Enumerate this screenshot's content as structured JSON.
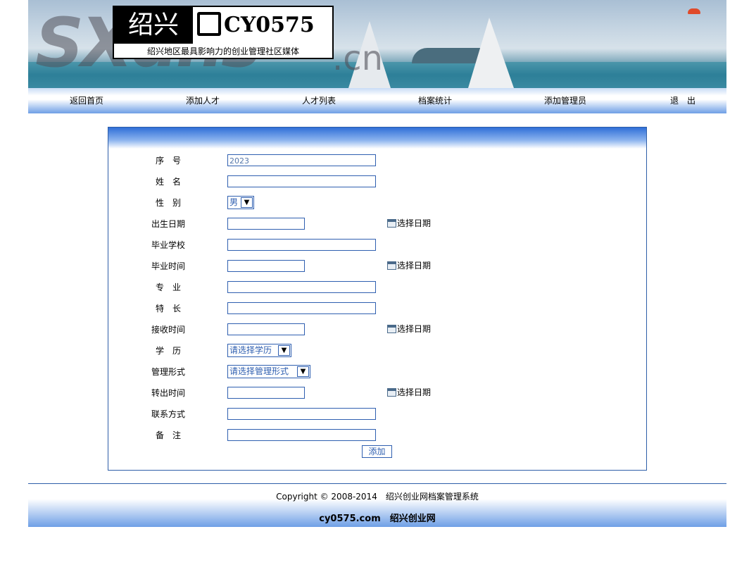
{
  "banner": {
    "logo_left": "绍兴",
    "logo_right": "CY0575",
    "logo_sub": "绍兴地区最具影响力的创业管理社区媒体",
    "watermark": "SXdns",
    "watermark_cn": ".cn"
  },
  "nav": {
    "items": [
      {
        "label": "返回首页"
      },
      {
        "label": "添加人才"
      },
      {
        "label": "人才列表"
      },
      {
        "label": "档案统计"
      },
      {
        "label": "添加管理员"
      },
      {
        "label": "退　出"
      }
    ]
  },
  "form": {
    "fields": {
      "serial": {
        "label": "序　号",
        "value": "2023"
      },
      "name": {
        "label": "姓　名",
        "value": ""
      },
      "gender": {
        "label": "性　别",
        "value": "男"
      },
      "birth_date": {
        "label": "出生日期",
        "value": ""
      },
      "school": {
        "label": "毕业学校",
        "value": ""
      },
      "grad_time": {
        "label": "毕业时间",
        "value": ""
      },
      "major": {
        "label": "专　业",
        "value": ""
      },
      "specialty": {
        "label": "特　长",
        "value": ""
      },
      "receive_time": {
        "label": "接收时间",
        "value": ""
      },
      "education": {
        "label": "学　历",
        "value": "请选择学历"
      },
      "manage_form": {
        "label": "管理形式",
        "value": "请选择管理形式"
      },
      "transfer_time": {
        "label": "转出时间",
        "value": ""
      },
      "contact": {
        "label": "联系方式",
        "value": ""
      },
      "remark": {
        "label": "备　注",
        "value": ""
      }
    },
    "pick_date_label": "选择日期",
    "submit_label": "添加"
  },
  "footer": {
    "copyright": "Copyright © 2008-2014　绍兴创业网档案管理系统",
    "site": "cy0575.com　绍兴创业网"
  },
  "colors": {
    "border": "#2e5ea8",
    "nav_gradient_bottom": "#6e9fe6"
  }
}
